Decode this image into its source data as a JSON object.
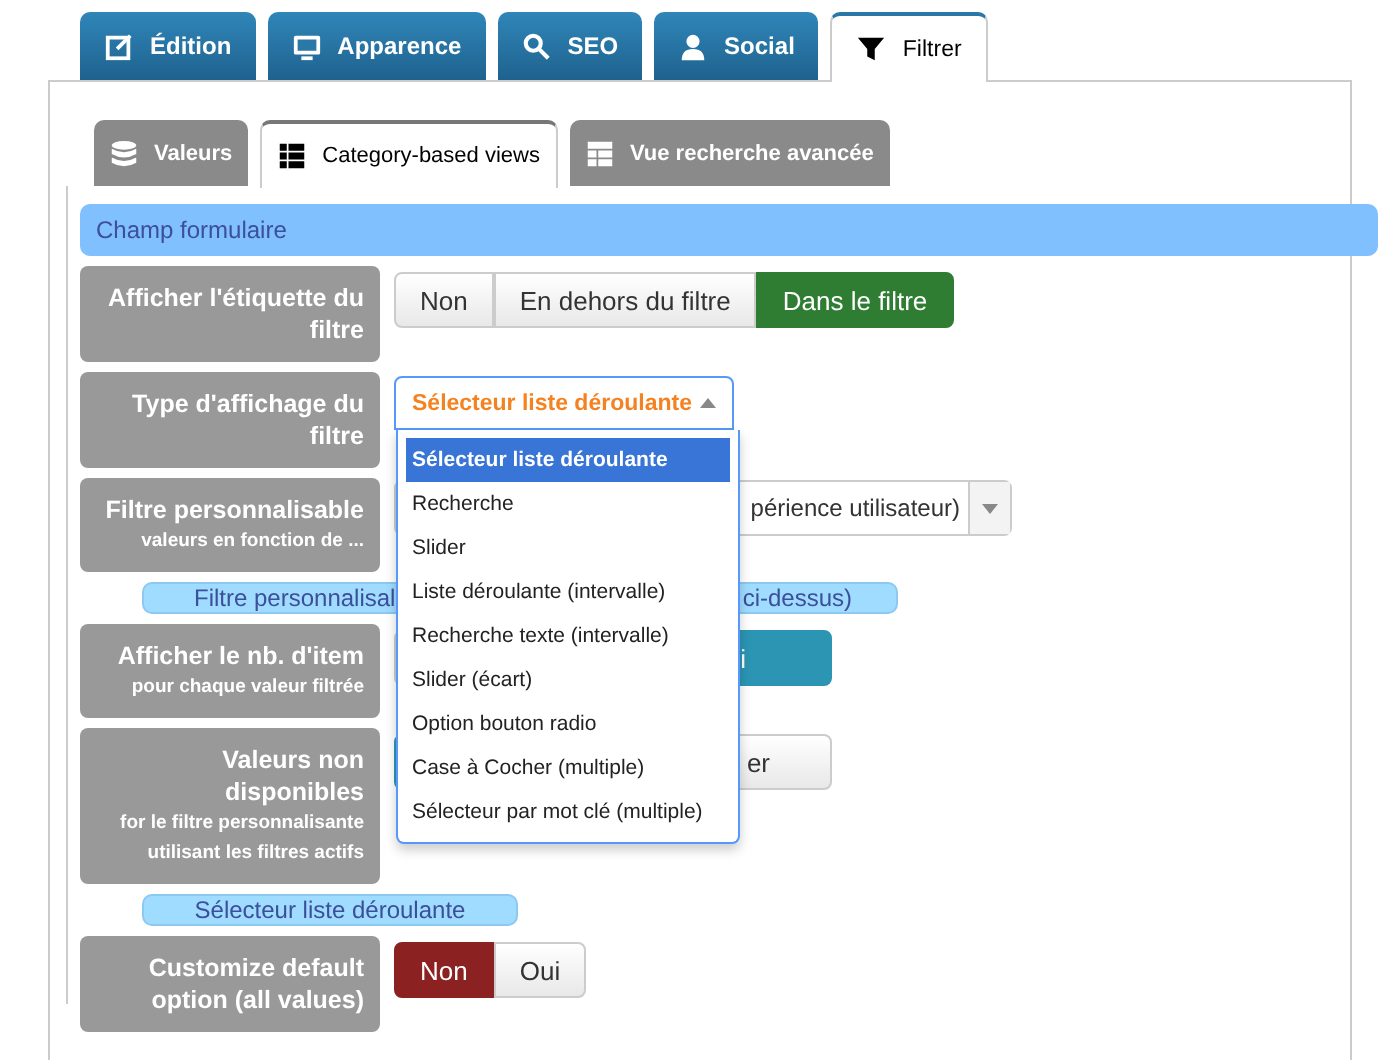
{
  "tabs": [
    {
      "label": "Édition",
      "selected": false
    },
    {
      "label": "Apparence",
      "selected": false
    },
    {
      "label": "SEO",
      "selected": false
    },
    {
      "label": "Social",
      "selected": false
    },
    {
      "label": "Filtrer",
      "selected": true
    }
  ],
  "subtabs": [
    {
      "label": "Valeurs",
      "selected": false
    },
    {
      "label": "Category-based views",
      "selected": true
    },
    {
      "label": "Vue recherche avancée",
      "selected": false
    }
  ],
  "section_header": "Champ formulaire",
  "rows": [
    {
      "kind": "buttons",
      "label": "Afficher l'étiquette du filtre",
      "color": "#2e7d32",
      "options": [
        {
          "label": "Non",
          "selected": false
        },
        {
          "label": "En dehors du filtre",
          "selected": false
        },
        {
          "label": "Dans le filtre",
          "selected": true
        }
      ]
    },
    {
      "kind": "dropdown",
      "label": "Type d'affichage du filtre",
      "value": "Sélecteur liste déroulante",
      "expanded": true,
      "items": [
        {
          "label": "Sélecteur liste déroulante",
          "selected": true
        },
        {
          "label": "Recherche",
          "selected": false
        },
        {
          "label": "Slider",
          "selected": false
        },
        {
          "label": "Liste déroulante (intervalle)",
          "selected": false
        },
        {
          "label": "Recherche texte (intervalle)",
          "selected": false
        },
        {
          "label": "Slider (écart)",
          "selected": false
        },
        {
          "label": "Option bouton radio",
          "selected": false
        },
        {
          "label": "Case à Cocher (multiple)",
          "selected": false
        },
        {
          "label": "Sélecteur par mot clé (multiple)",
          "selected": false
        }
      ]
    },
    {
      "kind": "select",
      "label": "Filtre personnalisable",
      "sublabel": "valeurs en fonction de ...",
      "value": "périence utilisateur)"
    },
    {
      "kind": "info",
      "parts": [
        "Filtre personnalisal",
        "ci-dessus)"
      ]
    },
    {
      "kind": "buttons",
      "label": "Afficher le nb. d'item",
      "sublabel": "pour chaque valeur filtrée",
      "color": "#2b95b3",
      "options": [
        {
          "selected": false
        },
        {
          "label": "i",
          "selected": true
        }
      ]
    },
    {
      "kind": "buttons",
      "label": "Valeurs non disponibles",
      "sublabel": "for le filtre personnalisante utilisant les filtres actifs",
      "color": "#2b95b3",
      "options": [
        {
          "selected": true
        },
        {
          "label": "er",
          "selected": false
        }
      ]
    },
    {
      "kind": "info",
      "parts": [
        "Sélecteur liste déroulante"
      ]
    },
    {
      "kind": "buttons",
      "label": "Customize default option (all values)",
      "color": "#8b2121",
      "options": [
        {
          "label": "Non",
          "selected": true
        },
        {
          "label": "Oui",
          "selected": false
        }
      ]
    }
  ]
}
